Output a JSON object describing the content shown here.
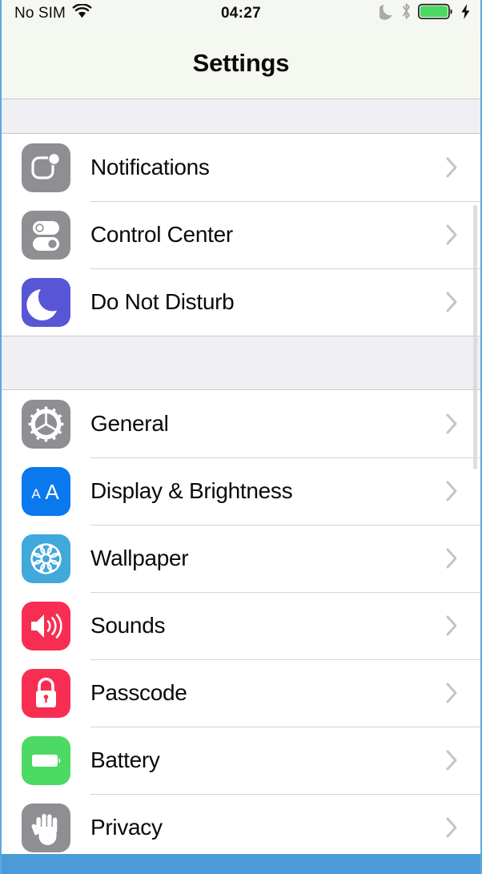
{
  "status_bar": {
    "carrier": "No SIM",
    "wifi_icon": "wifi-icon",
    "time": "04:27",
    "moon_icon": "moon-icon",
    "bluetooth_icon": "bluetooth-icon",
    "battery_icon": "battery-full-icon",
    "charging_icon": "lightning-bolt-icon",
    "battery_color": "#4CD964"
  },
  "nav": {
    "title": "Settings"
  },
  "groups": [
    {
      "id": "group-1",
      "rows": [
        {
          "label": "Notifications",
          "icon": "notifications-icon",
          "icon_color": "#8E8E93"
        },
        {
          "label": "Control Center",
          "icon": "control-center-icon",
          "icon_color": "#8E8E93"
        },
        {
          "label": "Do Not Disturb",
          "icon": "moon-icon",
          "icon_color": "#5756D5"
        }
      ]
    },
    {
      "id": "group-2",
      "rows": [
        {
          "label": "General",
          "icon": "gear-icon",
          "icon_color": "#8E8E93"
        },
        {
          "label": "Display & Brightness",
          "icon": "text-size-icon",
          "icon_color": "#0B79EE"
        },
        {
          "label": "Wallpaper",
          "icon": "flower-icon",
          "icon_color": "#41A8DB"
        },
        {
          "label": "Sounds",
          "icon": "speaker-icon",
          "icon_color": "#F72E52"
        },
        {
          "label": "Passcode",
          "icon": "lock-icon",
          "icon_color": "#F72E52"
        },
        {
          "label": "Battery",
          "icon": "battery-icon",
          "icon_color": "#4CD964"
        },
        {
          "label": "Privacy",
          "icon": "hand-icon",
          "icon_color": "#8E8E93"
        }
      ]
    }
  ],
  "chevron_icon": "chevron-right-icon",
  "colors": {
    "group_background": "#EFEFF4",
    "row_background": "#FFFFFF",
    "separator": "#D3D3D6",
    "bottom_bar": "#4A9BD8",
    "frame_border": "#5AAADF"
  }
}
